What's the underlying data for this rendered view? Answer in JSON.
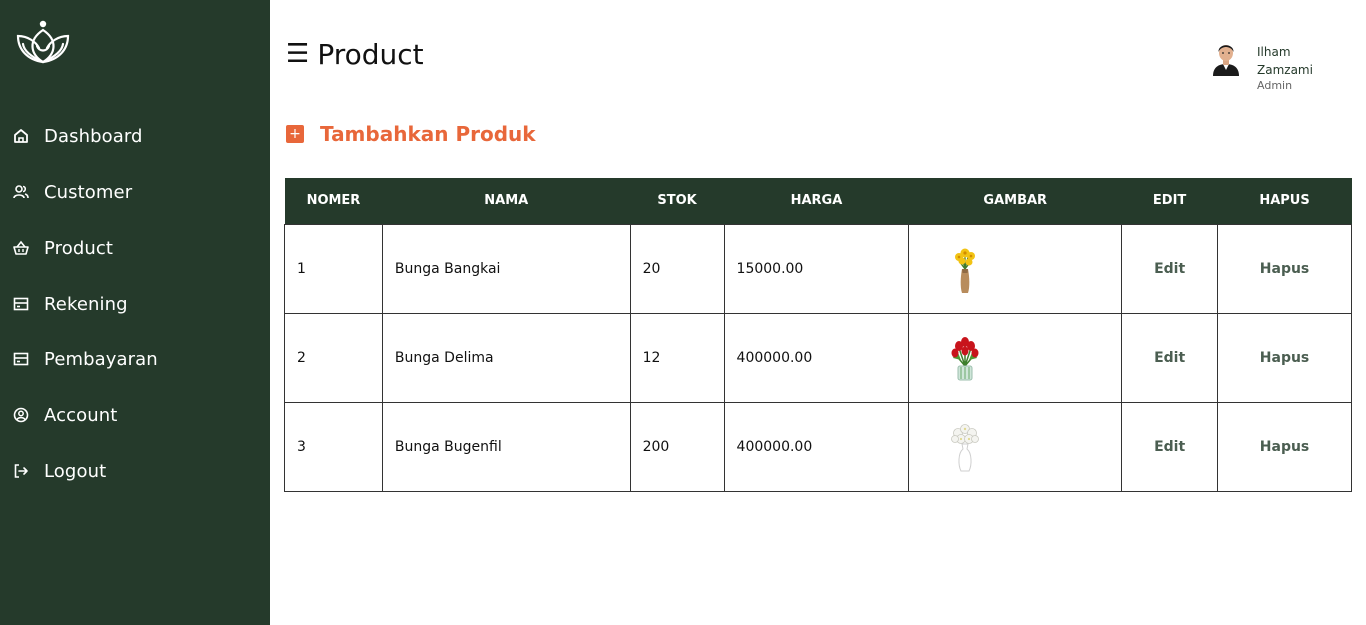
{
  "sidebar": {
    "logo": "lotus-logo",
    "items": [
      {
        "label": "Dashboard",
        "icon": "home-icon"
      },
      {
        "label": "Customer",
        "icon": "users-icon"
      },
      {
        "label": "Product",
        "icon": "basket-icon"
      },
      {
        "label": "Rekening",
        "icon": "card-icon"
      },
      {
        "label": "Pembayaran",
        "icon": "card-icon"
      },
      {
        "label": "Account",
        "icon": "user-circle-icon"
      },
      {
        "label": "Logout",
        "icon": "logout-icon"
      }
    ]
  },
  "header": {
    "menu_icon": "☰",
    "title": "Product",
    "user": {
      "name": "Ilham Zamzami",
      "role": "Admin"
    }
  },
  "actions": {
    "add_label": "Tambahkan Produk",
    "add_icon": "+"
  },
  "table": {
    "headers": [
      "NOMER",
      "NAMA",
      "STOK",
      "HARGA",
      "GAMBAR",
      "EDIT",
      "HAPUS"
    ],
    "rows": [
      {
        "no": "1",
        "nama": "Bunga Bangkai",
        "stok": "20",
        "harga": "15000.00",
        "gambar": "yellow-flowers-vase",
        "edit": "Edit",
        "hapus": "Hapus"
      },
      {
        "no": "2",
        "nama": "Bunga Delima",
        "stok": "12",
        "harga": "400000.00",
        "gambar": "red-tulips-vase",
        "edit": "Edit",
        "hapus": "Hapus"
      },
      {
        "no": "3",
        "nama": "Bunga Bugenfil",
        "stok": "200",
        "harga": "400000.00",
        "gambar": "white-flowers-vase",
        "edit": "Edit",
        "hapus": "Hapus"
      }
    ]
  },
  "colors": {
    "sidebar": "#253a2b",
    "accent": "#e8673a",
    "link": "#4b5e51"
  }
}
